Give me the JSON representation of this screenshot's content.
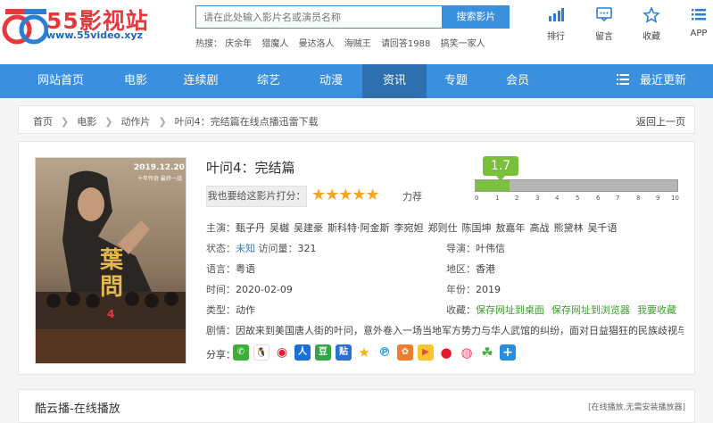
{
  "header": {
    "logo_text": "55",
    "site_name": "55影视站",
    "site_url": "www.55video.xyz",
    "search_placeholder": "请在此处输入影片名或演员名称",
    "search_button": "搜索影片",
    "hot_label": "热搜：",
    "hot_items": [
      "庆余年",
      "猎魔人",
      "曼达洛人",
      "海贼王",
      "请回答1988",
      "搞笑一家人"
    ],
    "top_links": [
      {
        "label": "排行",
        "icon": "bar-chart-icon"
      },
      {
        "label": "留言",
        "icon": "message-icon"
      },
      {
        "label": "收藏",
        "icon": "star-icon"
      },
      {
        "label": "APP",
        "icon": "list-icon"
      }
    ]
  },
  "nav": {
    "items": [
      "网站首页",
      "电影",
      "连续剧",
      "综艺",
      "动漫",
      "资讯",
      "专题",
      "会员"
    ],
    "active": "资讯",
    "recent": "最近更新"
  },
  "breadcrumb": {
    "items": [
      "首页",
      "电影",
      "动作片",
      "叶问4：完结篇在线点播迅雷下载"
    ],
    "back": "返回上一页"
  },
  "movie": {
    "title": "叶问4：完结篇",
    "rate_prompt": "我也要给这影片打分：",
    "stars": "★★★★★",
    "rate_word": "力荐",
    "score": "1.7",
    "score_value": 1.7,
    "score_max": 10,
    "score_ticks": [
      "0",
      "1",
      "2",
      "3",
      "4",
      "5",
      "6",
      "7",
      "8",
      "9",
      "10"
    ],
    "cast_label": "主演：",
    "cast": [
      "甄子丹",
      "吴樾",
      "吴建豪",
      "斯科特·阿金斯",
      "李宛妲",
      "郑则仕",
      "陈国坤",
      "敖嘉年",
      "高战",
      "熊黛林",
      "吴千语"
    ],
    "status_label": "状态：",
    "status_value": "未知",
    "views_label": "访问量：",
    "views": "321",
    "director_label": "导演：",
    "director": "叶伟信",
    "language_label": "语言：",
    "language": "粤语",
    "region_label": "地区：",
    "region": "香港",
    "time_label": "时间：",
    "time": "2020-02-09",
    "year_label": "年份：",
    "year": "2019",
    "type_label": "类型：",
    "type": "动作",
    "fav_label": "收藏：",
    "fav_links": [
      "保存网址到桌面",
      "保存网址到浏览器",
      "我要收藏"
    ],
    "plot_label": "剧情：",
    "plot": "因故来到美国唐人街的叶问，意外卷入一场当地军方势力与华人武馆的纠纷，面对日益猖狂的民族歧视与压",
    "share_label": "分享：",
    "poster": {
      "date": "2019.12.20",
      "tagline": "十年传奇 最终一战",
      "title_art": "葉問",
      "number": "4"
    }
  },
  "play": {
    "title": "酷云播-在线播放",
    "note": "[在线播放,无需安装播放器]"
  },
  "colors": {
    "brand_red": "#e8383d",
    "nav_blue": "#3a8fde",
    "score_green": "#78c03a",
    "star_orange": "#f5a623"
  }
}
